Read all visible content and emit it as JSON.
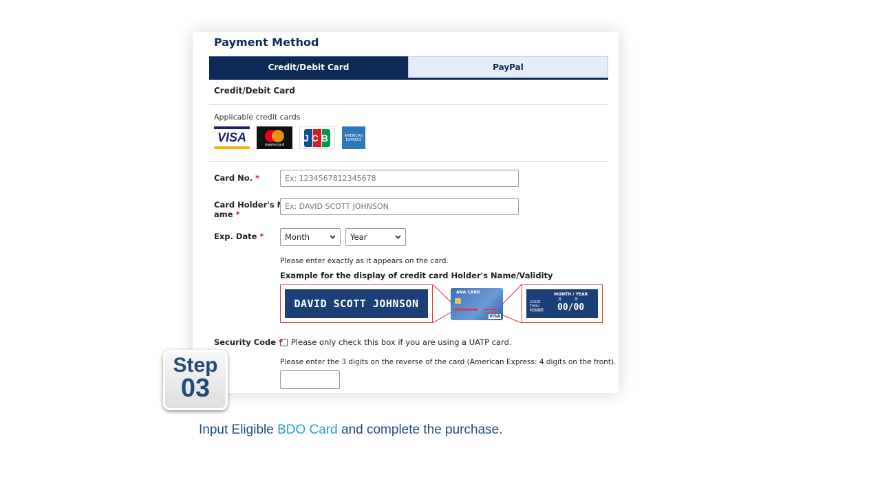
{
  "panel": {
    "title": "Payment Method",
    "tabs": [
      {
        "label": "Credit/Debit Card",
        "active": true
      },
      {
        "label": "PayPal",
        "active": false
      }
    ],
    "section_heading": "Credit/Debit Card",
    "applicable_label": "Applicable credit cards",
    "card_logos": {
      "visa": "VISA",
      "mastercard": "mastercard",
      "jcb": "JCB",
      "amex_line1": "AMERICAN",
      "amex_line2": "EXPRESS"
    },
    "required_mark": "*",
    "card_no": {
      "label": "Card No.",
      "placeholder": "Ex: 1234567812345678"
    },
    "holder_name": {
      "label_line1": "Card Holder's N",
      "label_line2": "ame",
      "placeholder": "Ex: DAVID SCOTT JOHNSON"
    },
    "exp_date": {
      "label": "Exp. Date",
      "month": "Month",
      "year": "Year"
    },
    "enter_note": "Please enter exactly as it appears on the card.",
    "example_heading": "Example for the display of credit card Holder's Name/Validity",
    "example": {
      "name": "DAVID SCOTT JOHNSON",
      "card_brand": "ANA CARD",
      "card_network": "VISA",
      "validity_header": "MONTH / YEAR",
      "validity_jp_month": "月",
      "validity_jp_year": "年",
      "good_thru_1": "GOOD",
      "good_thru_2": "THRU",
      "good_thru_jp": "有効期限",
      "validity_value": "00/00"
    },
    "security": {
      "label": "Security Code",
      "uatp_text": "Please only check this box if you are using a UATP card.",
      "note": "Please enter the 3 digits on the reverse of the card (American Express: 4 digits on the front)."
    }
  },
  "step": {
    "word": "Step",
    "number": "03"
  },
  "footer": {
    "before": "Input Eligible ",
    "highlight": "BDO Card",
    "after": " and complete the purchase."
  },
  "colors": {
    "navy": "#0b2a55",
    "accent": "#1fa0d8",
    "required": "#d01c1c"
  }
}
